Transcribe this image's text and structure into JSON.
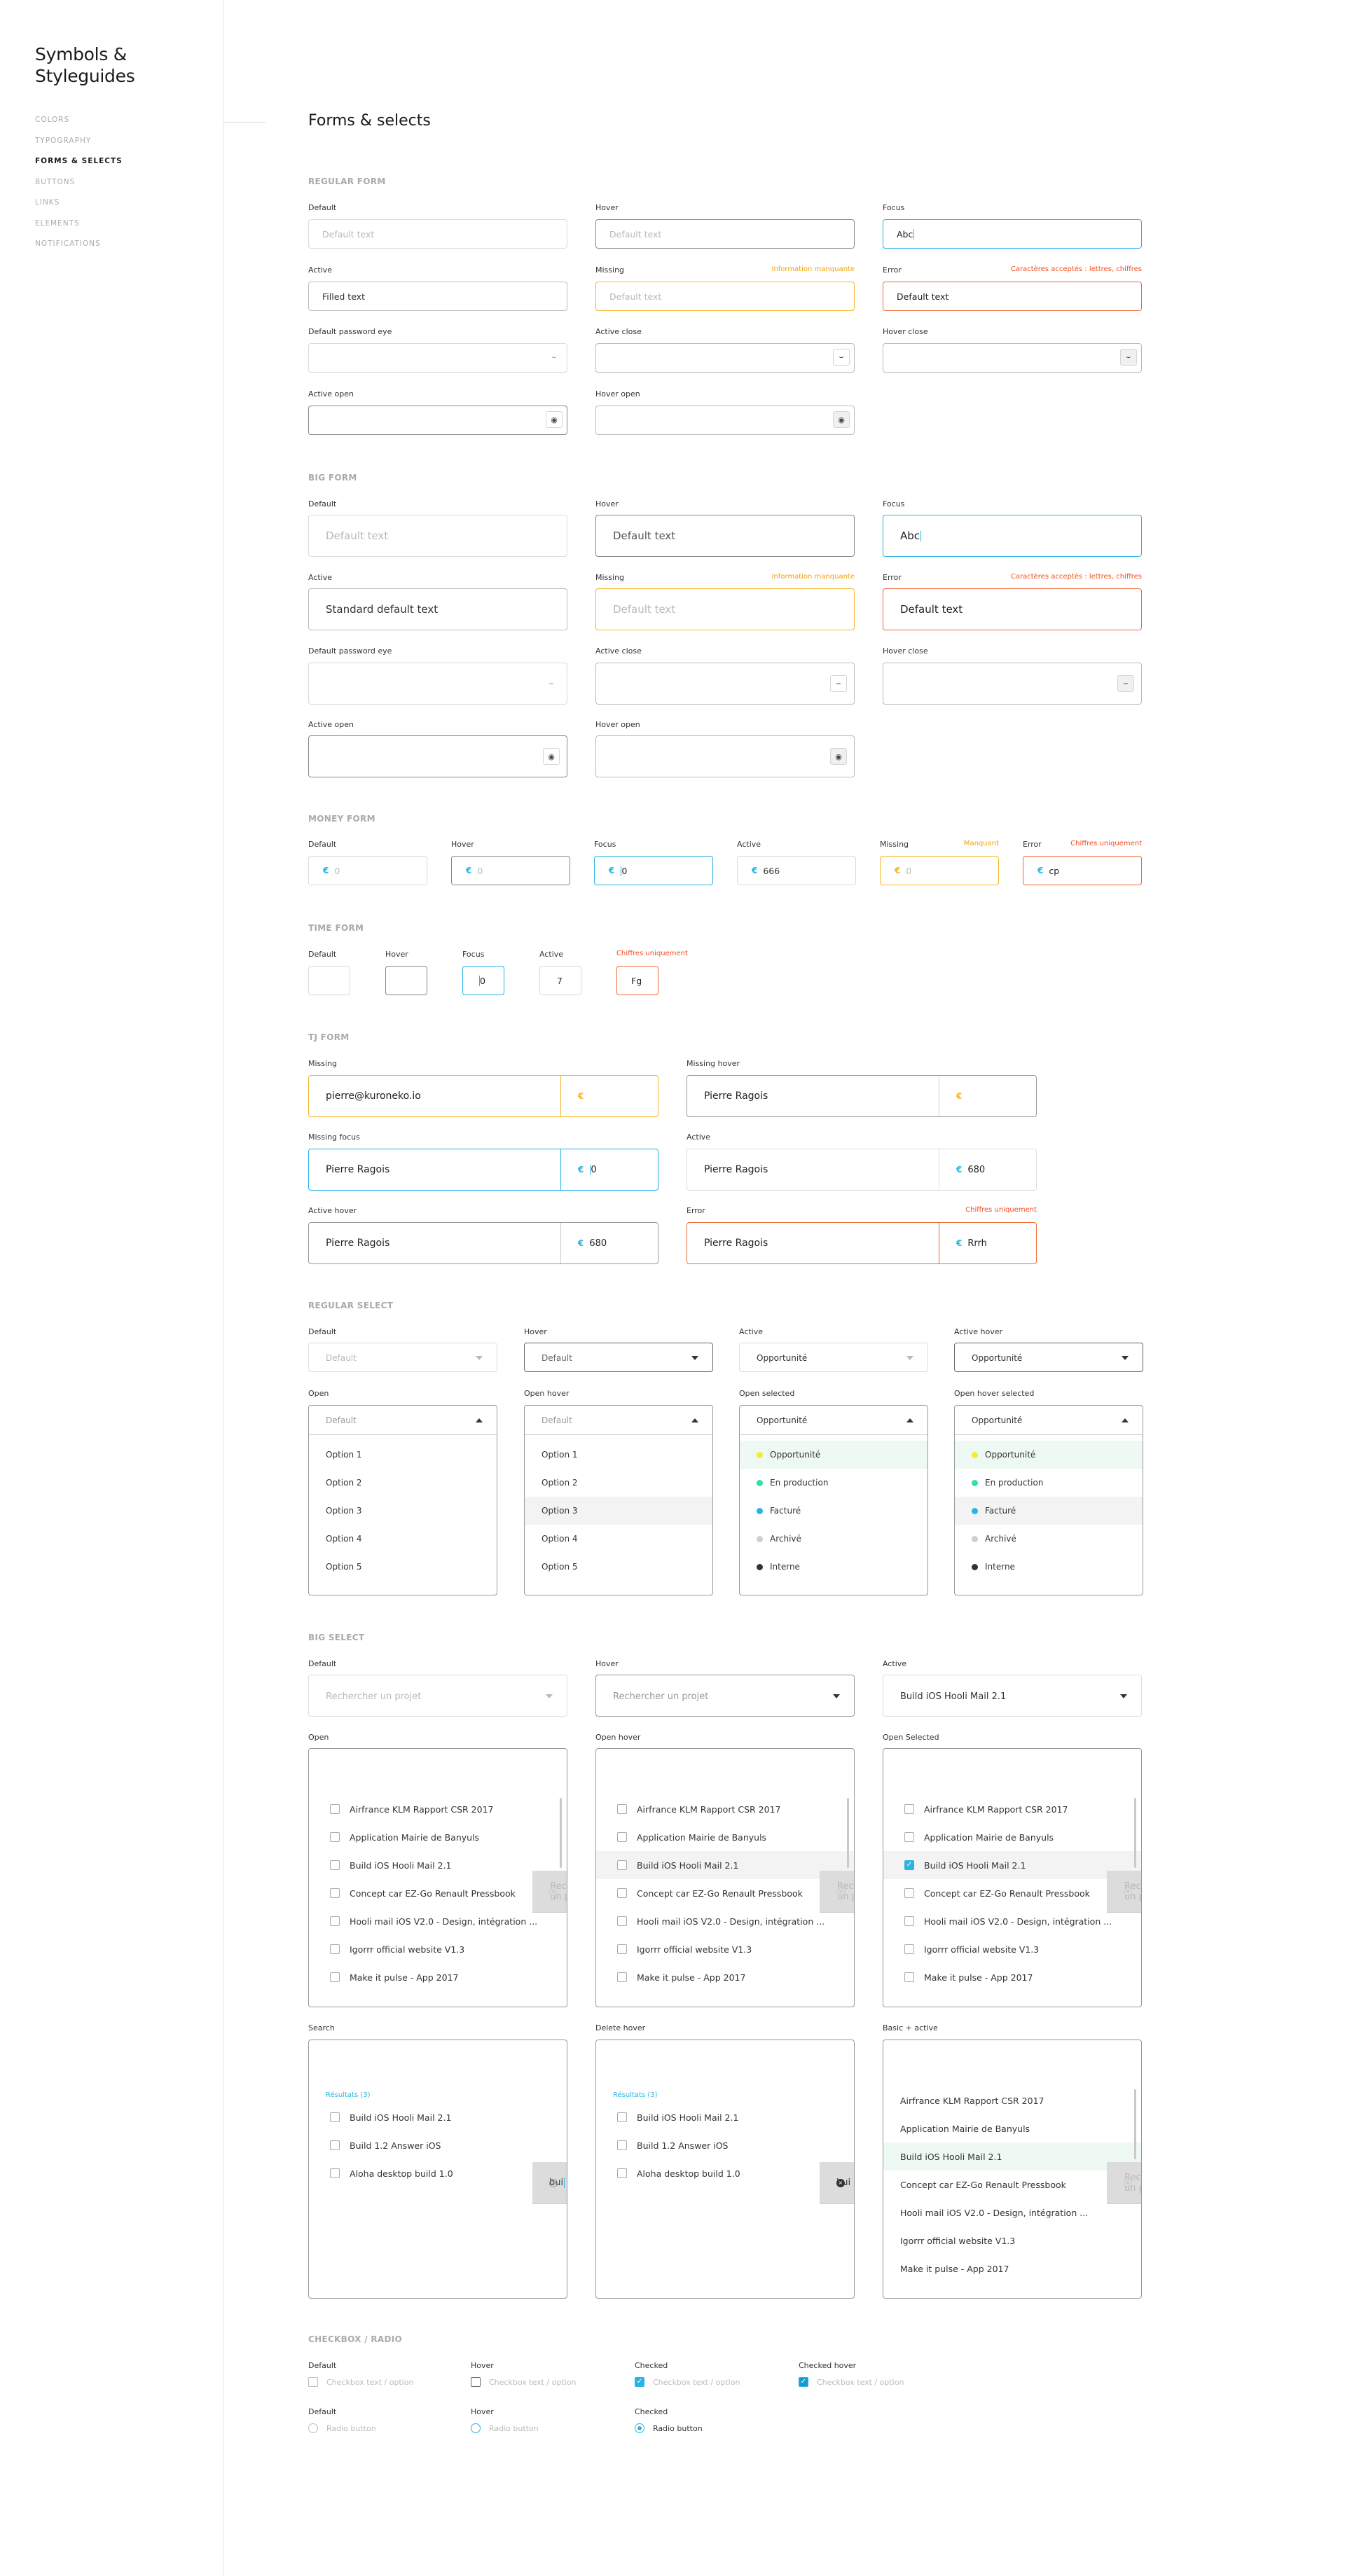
{
  "brand": {
    "line1": "Symbols &",
    "line2": "Styleguides"
  },
  "nav": [
    "COLORS",
    "TYPOGRAPHY",
    "FORMS & SELECTS",
    "BUTTONS",
    "LINKS",
    "ELEMENTS",
    "NOTIFICATIONS"
  ],
  "page_title": "Forms & selects",
  "colors": {
    "accent": "#2bb3e6",
    "warning": "#f5b52a",
    "error": "#f24d1e",
    "highlight": "#f2ee2f"
  },
  "regular": {
    "title": "REGULAR FORM",
    "l_default": "Default",
    "l_hover": "Hover",
    "l_focus": "Focus",
    "l_active": "Active",
    "l_missing": "Missing",
    "l_error": "Error",
    "l_pwd": "Default password eye",
    "l_aclose": "Active close",
    "l_hclose": "Hover close",
    "l_aopen": "Active open",
    "l_hopen": "Hover open",
    "default_text": "Default text",
    "focus_val": "Abc",
    "active_val": "Filled text",
    "missing_msg": "Information manquante",
    "error_msg": "Caractères acceptés : lettres, chiffres",
    "error_val": "Default text"
  },
  "big": {
    "title": "BIG FORM",
    "active_val": "Standard default text"
  },
  "money": {
    "title": "MONEY FORM",
    "l_default": "Default",
    "l_hover": "Hover",
    "l_focus": "Focus",
    "l_active": "Active",
    "l_missing": "Missing",
    "l_error": "Error",
    "missing_msg": "Manquant",
    "error_msg": "Chiffres uniquement",
    "zero": "0",
    "active_val": "666",
    "error_val": "cp",
    "euro": "€"
  },
  "time": {
    "title": "TIME FORM",
    "l_default": "Default",
    "l_hover": "Hover",
    "l_focus": "Focus",
    "l_active": "Active",
    "error_msg": "Chiffres uniquement",
    "focus_val": "0",
    "active_val": "7",
    "error_val": "Fg"
  },
  "tj": {
    "title": "TJ FORM",
    "l_missing": "Missing",
    "l_mhover": "Missing hover",
    "l_mfocus": "Missing focus",
    "l_active": "Active",
    "l_ahover": "Active hover",
    "l_error": "Error",
    "error_msg": "Chiffres uniquement",
    "email": "pierre@kuroneko.io",
    "name": "Pierre Ragois",
    "focus_val": "0",
    "val": "680",
    "err_val": "Rrrh"
  },
  "rselect": {
    "title": "REGULAR SELECT",
    "l_default": "Default",
    "l_hover": "Hover",
    "l_active": "Active",
    "l_ahover": "Active hover",
    "l_open": "Open",
    "l_ohover": "Open hover",
    "l_osel": "Open selected",
    "l_ohsel": "Open hover selected",
    "default": "Default",
    "value": "Opportunité",
    "options": [
      "Option 1",
      "Option 2",
      "Option 3",
      "Option 4",
      "Option 5"
    ],
    "status": [
      {
        "label": "Opportunité",
        "color": "#f2ee2f"
      },
      {
        "label": "En production",
        "color": "#2ee0b0"
      },
      {
        "label": "Facturé",
        "color": "#2bb3e6"
      },
      {
        "label": "Archivé",
        "color": "#cfcfcf"
      },
      {
        "label": "Interne",
        "color": "#333333"
      }
    ]
  },
  "bselect": {
    "title": "BIG SELECT",
    "l_default": "Default",
    "l_hover": "Hover",
    "l_active": "Active",
    "l_open": "Open",
    "l_ohover": "Open hover",
    "l_osel": "Open Selected",
    "l_search": "Search",
    "l_delhover": "Delete hover",
    "l_basic": "Basic + active",
    "placeholder": "Rechercher un projet",
    "active_val": "Build iOS Hooli Mail 2.1",
    "projects": [
      "Airfrance KLM Rapport CSR 2017",
      "Application Mairie de Banyuls",
      "Build iOS Hooli Mail 2.1",
      "Concept car EZ-Go Renault Pressbook",
      "Hooli mail iOS V2.0 - Design, intégration ...",
      "Igorrr official website V1.3",
      "Make it pulse - App 2017"
    ],
    "search": "bui",
    "results_label": "Résultats (3)",
    "results": [
      "Build iOS Hooli Mail 2.1",
      "Build 1.2 Answer iOS",
      "Aloha desktop build 1.0"
    ]
  },
  "check": {
    "title": "CHECKBOX / RADIO",
    "l_default": "Default",
    "l_hover": "Hover",
    "l_checked": "Checked",
    "l_chover": "Checked hover",
    "cb_text": "Checkbox text / option",
    "radio_text": "Radio button"
  }
}
